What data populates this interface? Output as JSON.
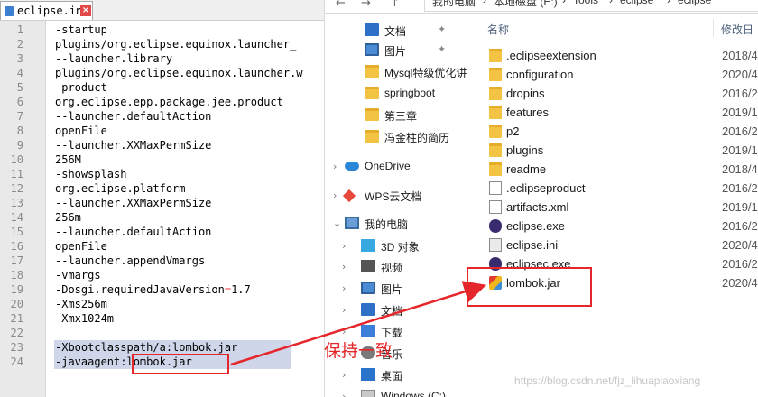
{
  "editor": {
    "tab_label": "eclipse.ini",
    "tab_close": "×",
    "lines": [
      {
        "n": "1",
        "text": "-startup"
      },
      {
        "n": "2",
        "text": "plugins/org.eclipse.equinox.launcher_"
      },
      {
        "n": "3",
        "text": "--launcher.library"
      },
      {
        "n": "4",
        "text": "plugins/org.eclipse.equinox.launcher.w"
      },
      {
        "n": "5",
        "text": "-product"
      },
      {
        "n": "6",
        "text": "org.eclipse.epp.package.jee.product"
      },
      {
        "n": "7",
        "text": "--launcher.defaultAction"
      },
      {
        "n": "8",
        "text": "openFile"
      },
      {
        "n": "9",
        "text": "--launcher.XXMaxPermSize"
      },
      {
        "n": "10",
        "text": "256M"
      },
      {
        "n": "11",
        "text": "-showsplash"
      },
      {
        "n": "12",
        "text": "org.eclipse.platform"
      },
      {
        "n": "13",
        "text": "--launcher.XXMaxPermSize"
      },
      {
        "n": "14",
        "text": "256m"
      },
      {
        "n": "15",
        "text": "--launcher.defaultAction"
      },
      {
        "n": "16",
        "text": "openFile"
      },
      {
        "n": "17",
        "text": "--launcher.appendVmargs"
      },
      {
        "n": "18",
        "text": "-vmargs"
      },
      {
        "n": "19",
        "text": "-Dosgi.requiredJavaVersion=1.7"
      },
      {
        "n": "20",
        "text": "-Xms256m"
      },
      {
        "n": "21",
        "text": "-Xmx1024m"
      },
      {
        "n": "22",
        "text": ""
      },
      {
        "n": "23",
        "text": "-Xbootclasspath/a:lombok.jar"
      },
      {
        "n": "24",
        "text": "-javaagent:lombok.jar"
      }
    ]
  },
  "explorer": {
    "breadcrumb": [
      "我的电脑",
      "本地磁盘 (E:)",
      "Tools",
      "eclipse",
      "eclipse"
    ],
    "columns": {
      "name": "名称",
      "date": "修改日"
    },
    "nav_items": [
      {
        "label": "文档",
        "icon": "documents-icon",
        "pinned": true
      },
      {
        "label": "图片",
        "icon": "pictures-icon",
        "pinned": true
      },
      {
        "label": "Mysql特级优化讲",
        "icon": "folder-icon"
      },
      {
        "label": "springboot",
        "icon": "folder-icon"
      },
      {
        "label": "第三章",
        "icon": "folder-icon"
      },
      {
        "label": "冯金柱的简历",
        "icon": "folder-icon"
      },
      {
        "label": "OneDrive",
        "icon": "onedrive-icon",
        "chevron": true
      },
      {
        "label": "WPS云文档",
        "icon": "wps-icon",
        "chevron": true
      },
      {
        "label": "我的电脑",
        "icon": "computer-icon",
        "chevron": true,
        "expanded": true
      },
      {
        "label": "3D 对象",
        "icon": "3d-objects-icon",
        "chevron": true,
        "indent": true
      },
      {
        "label": "视频",
        "icon": "videos-icon",
        "chevron": true,
        "indent": true
      },
      {
        "label": "图片",
        "icon": "pictures-icon",
        "chevron": true,
        "indent": true
      },
      {
        "label": "文档",
        "icon": "documents-icon",
        "chevron": true,
        "indent": true
      },
      {
        "label": "下载",
        "icon": "downloads-icon",
        "chevron": true,
        "indent": true
      },
      {
        "label": "音乐",
        "icon": "music-icon",
        "chevron": true,
        "indent": true
      },
      {
        "label": "桌面",
        "icon": "desktop-icon",
        "chevron": true,
        "indent": true
      },
      {
        "label": "Windows (C:)",
        "icon": "drive-icon",
        "chevron": true,
        "indent": true
      }
    ],
    "files": [
      {
        "name": ".eclipseextension",
        "date": "2018/4,",
        "type": "folder"
      },
      {
        "name": "configuration",
        "date": "2020/4,",
        "type": "folder"
      },
      {
        "name": "dropins",
        "date": "2016/2,",
        "type": "folder"
      },
      {
        "name": "features",
        "date": "2019/1,",
        "type": "folder"
      },
      {
        "name": "p2",
        "date": "2016/2,",
        "type": "folder"
      },
      {
        "name": "plugins",
        "date": "2019/1,",
        "type": "folder"
      },
      {
        "name": "readme",
        "date": "2018/4,",
        "type": "folder"
      },
      {
        "name": ".eclipseproduct",
        "date": "2016/2,",
        "type": "file"
      },
      {
        "name": "artifacts.xml",
        "date": "2019/1,",
        "type": "file"
      },
      {
        "name": "eclipse.exe",
        "date": "2016/2,",
        "type": "exe"
      },
      {
        "name": "eclipse.ini",
        "date": "2020/4,",
        "type": "ini"
      },
      {
        "name": "eclipsec.exe",
        "date": "2016/2,",
        "type": "exe"
      },
      {
        "name": "lombok.jar",
        "date": "2020/4,",
        "type": "jar"
      }
    ]
  },
  "annotation": {
    "note": "保持一致",
    "color": "#e5262a"
  },
  "watermark": "https://blog.csdn.net/fjz_lihuapiaoxiang"
}
